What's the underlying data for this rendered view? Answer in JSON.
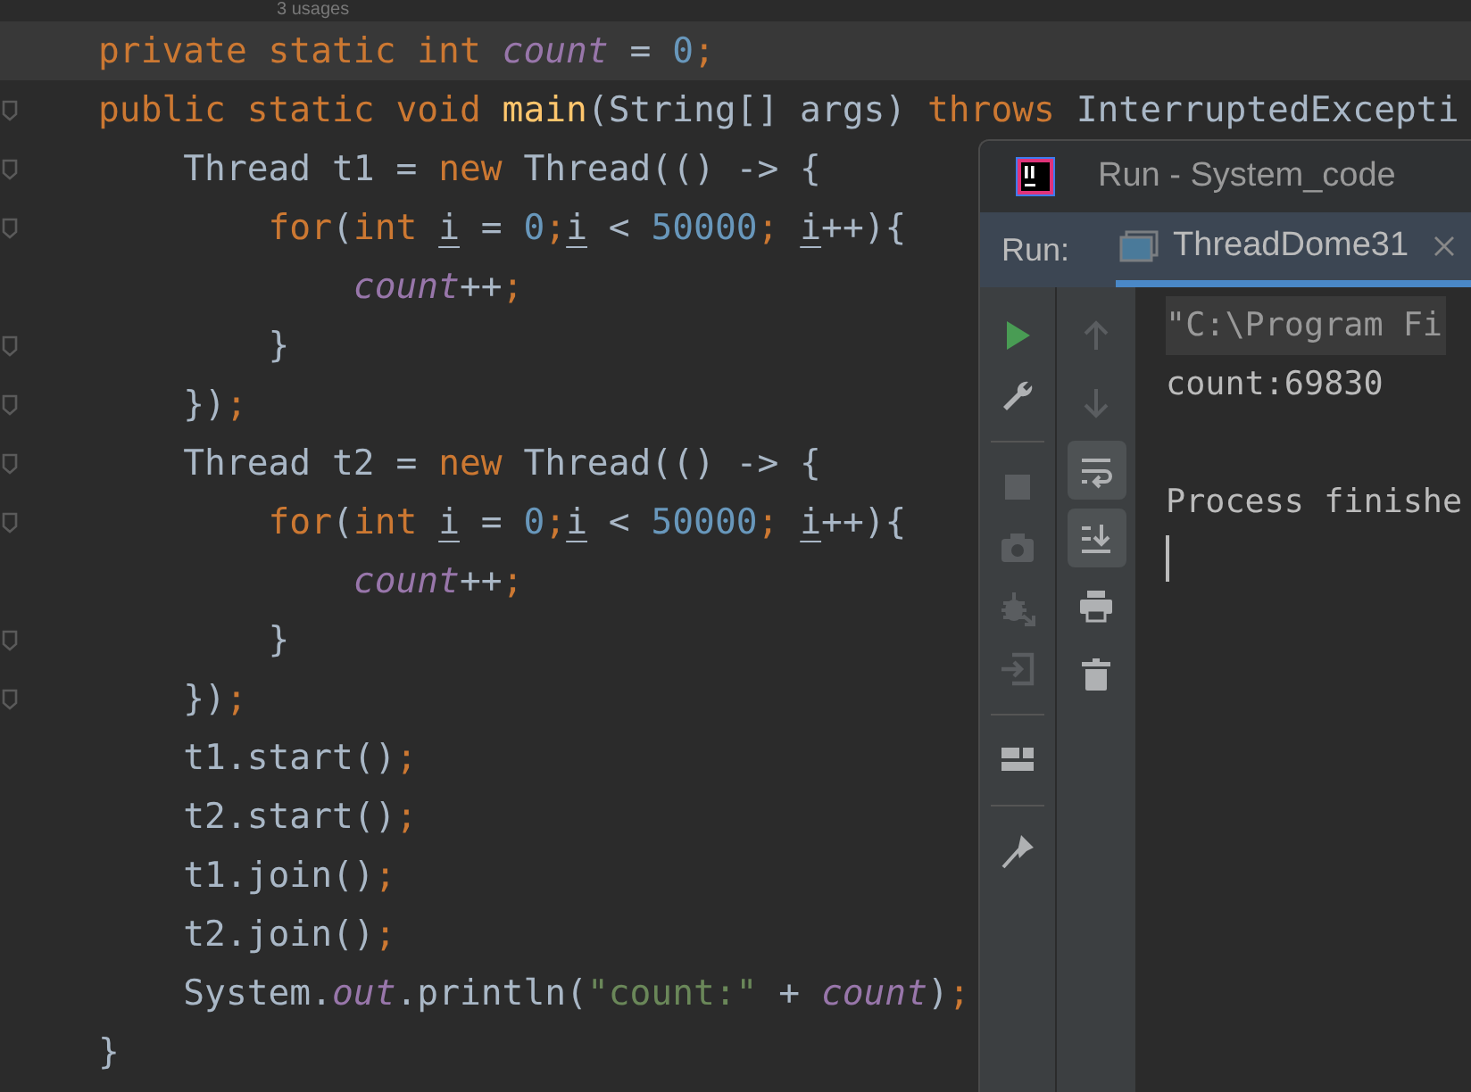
{
  "editor": {
    "usages_hint": "3 usages",
    "lines": [
      {
        "fold_marker": false,
        "highlighted": true,
        "tokens": [
          {
            "text": "private static int ",
            "kind": "keyword"
          },
          {
            "text": "count",
            "kind": "field"
          },
          {
            "text": " = ",
            "kind": "plain"
          },
          {
            "text": "0",
            "kind": "number"
          },
          {
            "text": ";",
            "kind": "semi"
          }
        ]
      },
      {
        "fold_marker": true,
        "highlighted": false,
        "tokens": [
          {
            "text": "public static void ",
            "kind": "keyword"
          },
          {
            "text": "main",
            "kind": "method"
          },
          {
            "text": "(String[] args) ",
            "kind": "plain"
          },
          {
            "text": "throws ",
            "kind": "keyword"
          },
          {
            "text": "InterruptedExcepti",
            "kind": "plain"
          }
        ]
      },
      {
        "fold_marker": true,
        "highlighted": false,
        "tokens": [
          {
            "text": "    Thread t1 = ",
            "kind": "plain"
          },
          {
            "text": "new ",
            "kind": "keyword"
          },
          {
            "text": "Thread(() -> {",
            "kind": "plain"
          }
        ]
      },
      {
        "fold_marker": true,
        "highlighted": false,
        "tokens": [
          {
            "text": "        for",
            "kind": "keyword"
          },
          {
            "text": "(",
            "kind": "plain"
          },
          {
            "text": "int ",
            "kind": "keyword"
          },
          {
            "text": "i",
            "kind": "local"
          },
          {
            "text": " = ",
            "kind": "plain"
          },
          {
            "text": "0",
            "kind": "number"
          },
          {
            "text": ";",
            "kind": "semi"
          },
          {
            "text": "i",
            "kind": "local"
          },
          {
            "text": " < ",
            "kind": "plain"
          },
          {
            "text": "50000",
            "kind": "number"
          },
          {
            "text": "; ",
            "kind": "semi"
          },
          {
            "text": "i",
            "kind": "local"
          },
          {
            "text": "++){",
            "kind": "plain"
          }
        ]
      },
      {
        "fold_marker": false,
        "highlighted": false,
        "tokens": [
          {
            "text": "            count",
            "kind": "field"
          },
          {
            "text": "++",
            "kind": "plain"
          },
          {
            "text": ";",
            "kind": "semi"
          }
        ]
      },
      {
        "fold_marker": true,
        "highlighted": false,
        "tokens": [
          {
            "text": "        }",
            "kind": "plain"
          }
        ]
      },
      {
        "fold_marker": true,
        "highlighted": false,
        "tokens": [
          {
            "text": "    })",
            "kind": "plain"
          },
          {
            "text": ";",
            "kind": "semi"
          }
        ]
      },
      {
        "fold_marker": true,
        "highlighted": false,
        "tokens": [
          {
            "text": "    Thread t2 = ",
            "kind": "plain"
          },
          {
            "text": "new ",
            "kind": "keyword"
          },
          {
            "text": "Thread(() -> {",
            "kind": "plain"
          }
        ]
      },
      {
        "fold_marker": true,
        "highlighted": false,
        "tokens": [
          {
            "text": "        for",
            "kind": "keyword"
          },
          {
            "text": "(",
            "kind": "plain"
          },
          {
            "text": "int ",
            "kind": "keyword"
          },
          {
            "text": "i",
            "kind": "local"
          },
          {
            "text": " = ",
            "kind": "plain"
          },
          {
            "text": "0",
            "kind": "number"
          },
          {
            "text": ";",
            "kind": "semi"
          },
          {
            "text": "i",
            "kind": "local"
          },
          {
            "text": " < ",
            "kind": "plain"
          },
          {
            "text": "50000",
            "kind": "number"
          },
          {
            "text": "; ",
            "kind": "semi"
          },
          {
            "text": "i",
            "kind": "local"
          },
          {
            "text": "++){",
            "kind": "plain"
          }
        ]
      },
      {
        "fold_marker": false,
        "highlighted": false,
        "tokens": [
          {
            "text": "            count",
            "kind": "field"
          },
          {
            "text": "++",
            "kind": "plain"
          },
          {
            "text": ";",
            "kind": "semi"
          }
        ]
      },
      {
        "fold_marker": true,
        "highlighted": false,
        "tokens": [
          {
            "text": "        }",
            "kind": "plain"
          }
        ]
      },
      {
        "fold_marker": true,
        "highlighted": false,
        "tokens": [
          {
            "text": "    })",
            "kind": "plain"
          },
          {
            "text": ";",
            "kind": "semi"
          }
        ]
      },
      {
        "fold_marker": false,
        "highlighted": false,
        "tokens": [
          {
            "text": "    t1.start()",
            "kind": "plain"
          },
          {
            "text": ";",
            "kind": "semi"
          }
        ]
      },
      {
        "fold_marker": false,
        "highlighted": false,
        "tokens": [
          {
            "text": "    t2.start()",
            "kind": "plain"
          },
          {
            "text": ";",
            "kind": "semi"
          }
        ]
      },
      {
        "fold_marker": false,
        "highlighted": false,
        "tokens": [
          {
            "text": "    t1.join()",
            "kind": "plain"
          },
          {
            "text": ";",
            "kind": "semi"
          }
        ]
      },
      {
        "fold_marker": false,
        "highlighted": false,
        "tokens": [
          {
            "text": "    t2.join()",
            "kind": "plain"
          },
          {
            "text": ";",
            "kind": "semi"
          }
        ]
      },
      {
        "fold_marker": false,
        "highlighted": false,
        "tokens": [
          {
            "text": "    System.",
            "kind": "plain"
          },
          {
            "text": "out",
            "kind": "field"
          },
          {
            "text": ".println(",
            "kind": "plain"
          },
          {
            "text": "\"count:\"",
            "kind": "string"
          },
          {
            "text": " + ",
            "kind": "plain"
          },
          {
            "text": "count",
            "kind": "field"
          },
          {
            "text": ")",
            "kind": "plain"
          },
          {
            "text": ";",
            "kind": "semi"
          }
        ]
      },
      {
        "fold_marker": false,
        "highlighted": false,
        "tokens": [
          {
            "text": "}",
            "kind": "plain"
          }
        ]
      }
    ]
  },
  "run_window": {
    "title": "Run - System_code",
    "run_label": "Run:",
    "tabs": [
      {
        "label": "ThreadDome31",
        "selected": true
      }
    ],
    "left_toolbar": [
      {
        "kind": "run",
        "disabled": false
      },
      {
        "kind": "wrench",
        "disabled": false
      },
      {
        "kind": "separator"
      },
      {
        "kind": "stop",
        "disabled": true
      },
      {
        "kind": "camera",
        "disabled": true
      },
      {
        "kind": "bug",
        "disabled": true
      },
      {
        "kind": "login",
        "disabled": true
      },
      {
        "kind": "separator"
      },
      {
        "kind": "layout",
        "disabled": false
      },
      {
        "kind": "separator"
      },
      {
        "kind": "pin",
        "disabled": false
      }
    ],
    "right_toolbar": [
      {
        "kind": "up",
        "disabled": true,
        "on": false
      },
      {
        "kind": "down",
        "disabled": true,
        "on": false
      },
      {
        "kind": "wrap",
        "disabled": false,
        "on": true
      },
      {
        "kind": "scrollend",
        "disabled": false,
        "on": true
      },
      {
        "kind": "print",
        "disabled": false,
        "on": false
      },
      {
        "kind": "trash",
        "disabled": false,
        "on": false
      }
    ],
    "console_blocks": [
      {
        "lines": [
          {
            "text": "\"C:\\Program Fi",
            "kind": "command"
          },
          {
            "text": "count:69830",
            "kind": "output"
          }
        ]
      },
      {
        "lines": [
          {
            "text": "Process finishe",
            "kind": "output"
          }
        ]
      }
    ]
  }
}
